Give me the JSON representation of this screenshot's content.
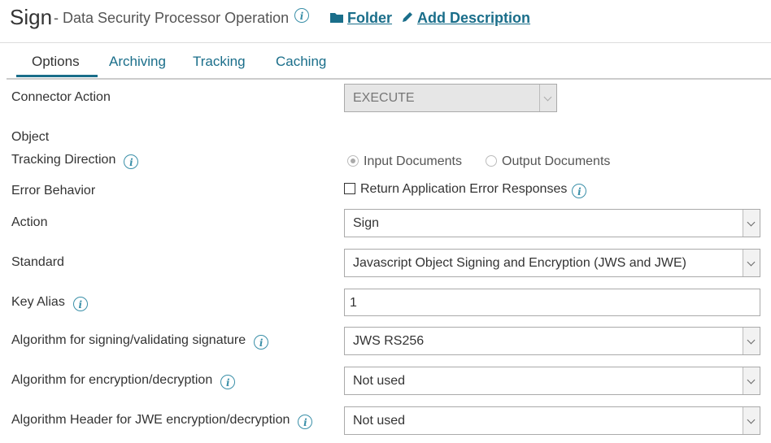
{
  "header": {
    "title": "Sign",
    "subtitle": "- Data Security Processor Operation",
    "folder_label": "Folder",
    "add_description_label": "Add Description"
  },
  "tabs": [
    {
      "label": "Options",
      "active": true
    },
    {
      "label": "Archiving",
      "active": false
    },
    {
      "label": "Tracking",
      "active": false
    },
    {
      "label": "Caching",
      "active": false
    }
  ],
  "form": {
    "connector_action": {
      "label": "Connector Action",
      "value": "EXECUTE"
    },
    "object": {
      "label": "Object"
    },
    "tracking_direction": {
      "label": "Tracking Direction",
      "option_input": "Input Documents",
      "option_output": "Output Documents",
      "selected": "Input Documents"
    },
    "error_behavior": {
      "label": "Error Behavior",
      "checkbox_label": "Return Application Error Responses",
      "checked": false
    },
    "action": {
      "label": "Action",
      "value": "Sign"
    },
    "standard": {
      "label": "Standard",
      "value": "Javascript Object Signing and Encryption (JWS and JWE)"
    },
    "key_alias": {
      "label": "Key Alias",
      "value": "1"
    },
    "signing_algorithm": {
      "label": "Algorithm for signing/validating signature",
      "value": "JWS RS256"
    },
    "encryption_algorithm": {
      "label": "Algorithm for encryption/decryption",
      "value": "Not used"
    },
    "jwe_header_algorithm": {
      "label": "Algorithm Header for JWE encryption/decryption",
      "value": "Not used"
    }
  },
  "colors": {
    "accent": "#1a6e8a",
    "info": "#3a8fa8"
  }
}
